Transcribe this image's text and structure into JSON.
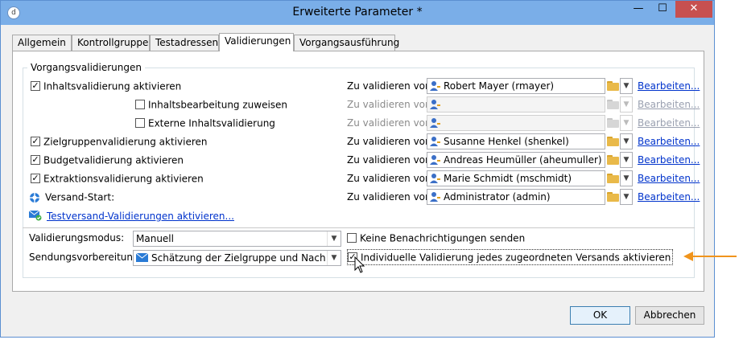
{
  "window": {
    "title": "Erweiterte Parameter *",
    "controls": {
      "minimize": "—",
      "maximize": "☐",
      "close": "✕"
    }
  },
  "tabs": [
    {
      "label": "Allgemein"
    },
    {
      "label": "Kontrollgruppe"
    },
    {
      "label": "Testadressen"
    },
    {
      "label": "Validierungen",
      "active": true
    },
    {
      "label": "Vorgangsausführung"
    }
  ],
  "group": {
    "legend": "Vorgangsvalidierungen",
    "validate_label": "Zu validieren von:",
    "edit_link": "Bearbeiten...",
    "rows": [
      {
        "label": "Inhaltsvalidierung aktivieren",
        "checked": true,
        "value": "Robert Mayer (rmayer)",
        "enabled": true
      },
      {
        "label": "Inhaltsbearbeitung zuweisen",
        "checked": false,
        "value": "",
        "enabled": false
      },
      {
        "label": "Externe Inhaltsvalidierung",
        "checked": false,
        "value": "",
        "enabled": false
      },
      {
        "label": "Zielgruppenvalidierung aktivieren",
        "checked": true,
        "value": "Susanne Henkel (shenkel)",
        "enabled": true
      },
      {
        "label": "Budgetvalidierung aktivieren",
        "checked": true,
        "value": "Andreas Heumüller (aheumuller)",
        "enabled": true
      },
      {
        "label": "Extraktionsvalidierung aktivieren",
        "checked": true,
        "value": "Marie Schmidt (mschmidt)",
        "enabled": true
      },
      {
        "label": "Versand-Start:",
        "checked": null,
        "value": "Administrator (admin)",
        "enabled": true
      }
    ],
    "test_link": "Testversand-Validierungen aktivieren..."
  },
  "mode": {
    "label": "Validierungsmodus:",
    "value": "Manuell"
  },
  "prep": {
    "label": "Sendungsvorbereitung:",
    "value": "Schätzung der Zielgruppe und Nachrichte"
  },
  "options": {
    "no_notifications": {
      "label": "Keine Benachrichtigungen senden",
      "checked": false
    },
    "individual": {
      "label": "Individuelle Validierung jedes zugeordneten Versands aktivieren",
      "checked": true
    }
  },
  "buttons": {
    "ok": "OK",
    "cancel": "Abbrechen"
  },
  "colors": {
    "accent": "#7aaee8",
    "link": "#0033cc",
    "arrow": "#f0941c"
  }
}
